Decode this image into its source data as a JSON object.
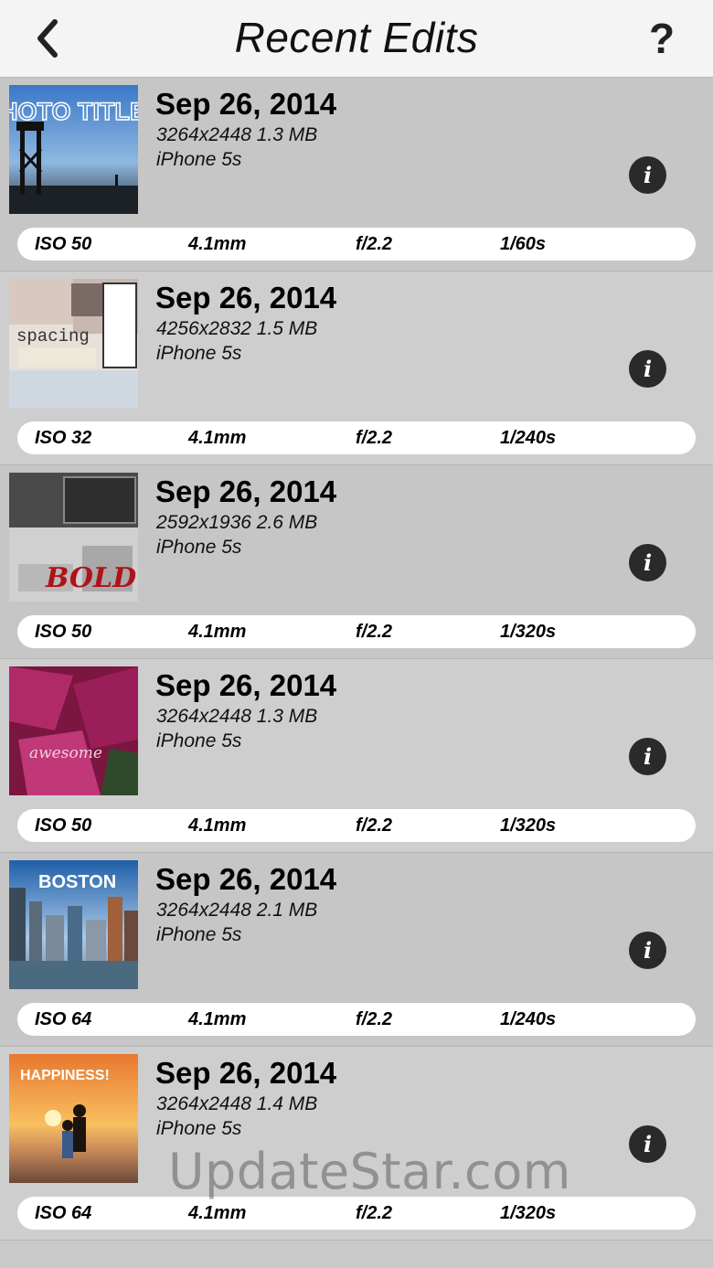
{
  "nav": {
    "title": "Recent Edits",
    "help_label": "?"
  },
  "items": [
    {
      "date": "Sep 26, 2014",
      "meta": "3264x2448 1.3 MB",
      "model": "iPhone 5s",
      "info": "i",
      "thumb_text": "PHOTO TITLES",
      "exif": {
        "iso": "ISO 50",
        "focal": "4.1mm",
        "aperture": "f/2.2",
        "shutter": "1/60s"
      }
    },
    {
      "date": "Sep 26, 2014",
      "meta": "4256x2832 1.5 MB",
      "model": "iPhone 5s",
      "info": "i",
      "thumb_text": "spacing",
      "exif": {
        "iso": "ISO 32",
        "focal": "4.1mm",
        "aperture": "f/2.2",
        "shutter": "1/240s"
      }
    },
    {
      "date": "Sep 26, 2014",
      "meta": "2592x1936 2.6 MB",
      "model": "iPhone 5s",
      "info": "i",
      "thumb_text": "BOLD",
      "exif": {
        "iso": "ISO 50",
        "focal": "4.1mm",
        "aperture": "f/2.2",
        "shutter": "1/320s"
      }
    },
    {
      "date": "Sep 26, 2014",
      "meta": "3264x2448 1.3 MB",
      "model": "iPhone 5s",
      "info": "i",
      "thumb_text": "awesome",
      "exif": {
        "iso": "ISO 50",
        "focal": "4.1mm",
        "aperture": "f/2.2",
        "shutter": "1/320s"
      }
    },
    {
      "date": "Sep 26, 2014",
      "meta": "3264x2448 2.1 MB",
      "model": "iPhone 5s",
      "info": "i",
      "thumb_text": "BOSTON",
      "exif": {
        "iso": "ISO 64",
        "focal": "4.1mm",
        "aperture": "f/2.2",
        "shutter": "1/240s"
      }
    },
    {
      "date": "Sep 26, 2014",
      "meta": "3264x2448 1.4 MB",
      "model": "iPhone 5s",
      "info": "i",
      "thumb_text": "HAPPINESS!",
      "exif": {
        "iso": "ISO 64",
        "focal": "4.1mm",
        "aperture": "f/2.2",
        "shutter": "1/320s"
      }
    }
  ],
  "watermark": "UpdateStar.com"
}
